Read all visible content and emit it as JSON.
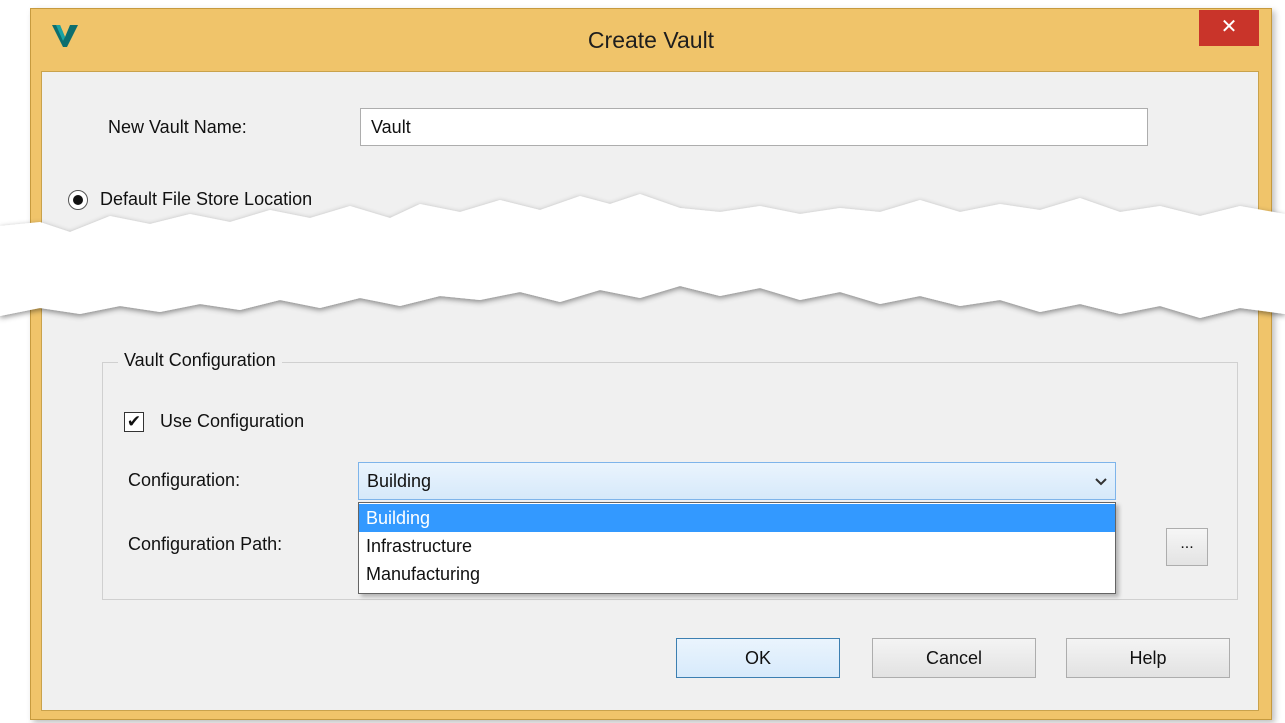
{
  "window": {
    "title": "Create Vault",
    "close_glyph": "✕",
    "icon": "vault-app-icon"
  },
  "form": {
    "vault_name_label": "New Vault Name:",
    "vault_name_value": "Vault",
    "file_store_option_label": "Default File Store Location",
    "file_store_selected": true
  },
  "config_group": {
    "title": "Vault Configuration",
    "use_config_label": "Use Configuration",
    "use_config_checked": true,
    "check_glyph": "✔",
    "configuration_label": "Configuration:",
    "configuration_value": "Building",
    "combo_arrow": "⌄",
    "options": [
      "Building",
      "Infrastructure",
      "Manufacturing"
    ],
    "selected_option": "Building",
    "path_label": "Configuration Path:",
    "browse_label": "..."
  },
  "buttons": {
    "ok": "OK",
    "cancel": "Cancel",
    "help": "Help"
  },
  "colors": {
    "title_bar": "#f0c46a",
    "close_button": "#c9342a",
    "selection": "#3399ff",
    "client_background": "#f0f0f0"
  }
}
